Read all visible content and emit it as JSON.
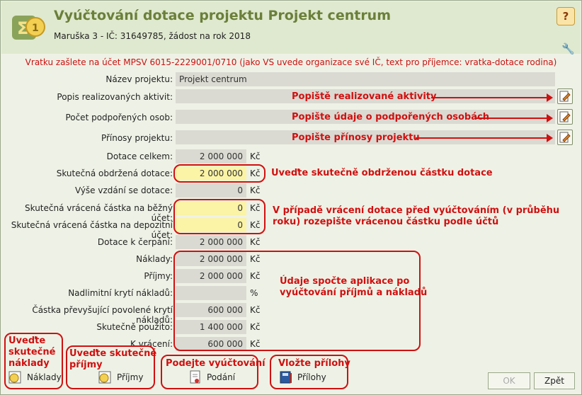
{
  "header": {
    "title": "Vyúčtování dotace projektu Projekt centrum",
    "subtitle": "Maruška 3 - IČ: 31649785, žádost na rok 2018"
  },
  "notice": "Vratku zašlete na účet MPSV 6015-2229001/0710 (jako VS uvede organizace své IČ, text pro příjemce: vratka-dotace rodina)",
  "rows": {
    "nazev": {
      "label": "Název projektu:",
      "value": "Projekt centrum"
    },
    "popis": {
      "label": "Popis realizovaných aktivit:",
      "value": ""
    },
    "pocet": {
      "label": "Počet podpořených osob:",
      "value": ""
    },
    "prinosy": {
      "label": "Přínosy projektu:",
      "value": ""
    },
    "dotace_celkem": {
      "label": "Dotace celkem:",
      "value": "2 000 000",
      "unit": "Kč"
    },
    "skutecna_obdrzena": {
      "label": "Skutečná obdržená dotace:",
      "value": "2 000 000",
      "unit": "Kč"
    },
    "vyse_vzdani": {
      "label": "Výše vzdání se dotace:",
      "value": "0",
      "unit": "Kč"
    },
    "vracena_bezny": {
      "label": "Skutečná vrácená částka na běžný účet:",
      "value": "0",
      "unit": "Kč"
    },
    "vracena_depozitni": {
      "label": "Skutečná vrácená částka na depozitní účet:",
      "value": "0",
      "unit": "Kč"
    },
    "dotace_cerpani": {
      "label": "Dotace k čerpání:",
      "value": "2 000 000",
      "unit": "Kč"
    },
    "naklady": {
      "label": "Náklady:",
      "value": "2 000 000",
      "unit": "Kč"
    },
    "prijmy": {
      "label": "Příjmy:",
      "value": "2 000 000",
      "unit": "Kč"
    },
    "nadlimitni": {
      "label": "Nadlimitní krytí nákladů:",
      "value": "",
      "unit": "%"
    },
    "castka_prevysujici": {
      "label": "Částka převyšující povolené krytí nákladů:",
      "value": "600 000",
      "unit": "Kč"
    },
    "skutecne_pouzito": {
      "label": "Skutečně použito:",
      "value": "1 400 000",
      "unit": "Kč"
    },
    "k_vraceni": {
      "label": "K vrácení:",
      "value": "600 000",
      "unit": "Kč"
    }
  },
  "annotations": {
    "popis": "Popiště realizované aktivity",
    "pocet": "Popište údaje o podpořených osobách",
    "prinosy": "Popište přínosy projektu",
    "obdrzena": "Uveďte skutečně obdrženou částku dotace",
    "vraceni_line1": "V případě vrácení dotace před vyúčtováním (v průběhu",
    "vraceni_line2": "roku) rozepište vrácenou částku podle účtů",
    "spocte_line1": "Údaje spočte aplikace po",
    "spocte_line2": "vyúčtování příjmů a nákladů",
    "naklady_line1": "Uveďte",
    "naklady_line2": "skutečné",
    "naklady_line3": "náklady",
    "prijmy_line1": "Uveďte skutečné",
    "prijmy_line2": "příjmy",
    "podani": "Podejte vyúčtování",
    "prilohy": "Vložte přílohy"
  },
  "buttons": {
    "naklady": "Náklady",
    "prijmy": "Příjmy",
    "podani": "Podání",
    "prilohy": "Přílohy",
    "ok": "OK",
    "zpet": "Zpět"
  },
  "colors": {
    "accent": "#6b7f3a",
    "annotation": "#d01010",
    "highlight": "#fbf3a6"
  }
}
